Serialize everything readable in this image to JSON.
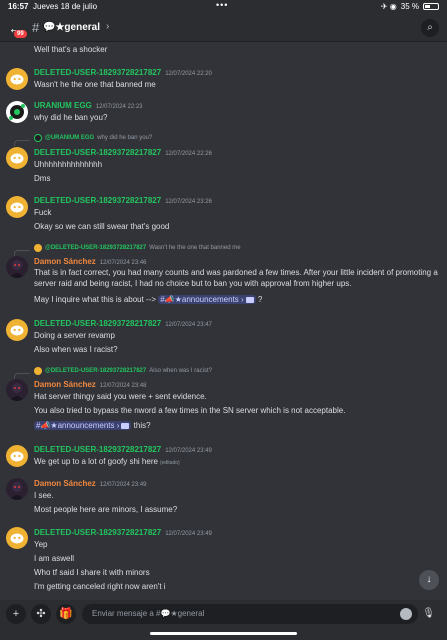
{
  "status": {
    "time": "16:57",
    "date": "Jueves 18 de julio",
    "dots": "•••",
    "icons": "✈ ◉",
    "battery": "35 %",
    "battery_level": 0.35
  },
  "header": {
    "back": "←",
    "unread_badge": "99",
    "hash": "#",
    "title": "💬★general",
    "chevron": "›",
    "search_icon": "⌕"
  },
  "messages": {
    "m0": {
      "text": "Well that's a shocker"
    },
    "m1": {
      "author": "DELETED-USER-18293728217827",
      "time": "12/07/2024 22:20",
      "text": "Wasn't he the one that banned me"
    },
    "m2": {
      "author": "URANIUM EGG",
      "time": "12/07/2024 22:23",
      "text": "why did he ban you?"
    },
    "m3": {
      "reply_name": "@URANIUM EGG",
      "reply_text": "why did he ban you?",
      "author": "DELETED-USER-18293728217827",
      "time": "12/07/2024 22:26",
      "text1": "Uhhhhhhhhhhhhhh",
      "text2": "Dms"
    },
    "m4": {
      "author": "DELETED-USER-18293728217827",
      "time": "12/07/2024 23:26",
      "text1": "Fuck",
      "text2": "Okay so we can still swear that's good"
    },
    "m5": {
      "reply_name": "@DELETED-USER-18293728217827",
      "reply_text": "Wasn't he the one that banned me",
      "author": "Damon Sánchez",
      "time": "12/07/2024 23:46",
      "text1": "That is in fact correct, you had many counts and was pardoned a few times. After your little incident of promoting a server raid and being racist, I had no choice but to ban you with approval from higher ups.",
      "text2_pre": "May I inquire what this is about --> ",
      "mention": "#📣★announcements",
      "mention_chev": "›",
      "text2_post": " ?"
    },
    "m6": {
      "author": "DELETED-USER-18293728217827",
      "time": "12/07/2024 23:47",
      "text1": "Doing a server revamp",
      "text2": "Also when was I racist?"
    },
    "m7": {
      "reply_name": "@DELETED-USER-18293728217827",
      "reply_text": "Also when was I racist?",
      "author": "Damon Sánchez",
      "time": "12/07/2024 23:48",
      "text1": "Hat server thingy said you were + sent evidence.",
      "text2": "You also tried to bypass the nword a few times in the SN server which is not acceptable.",
      "mention": "#📣★announcements",
      "mention_chev": "›",
      "text3_post": " this?"
    },
    "m8": {
      "author": "DELETED-USER-18293728217827",
      "time": "12/07/2024 23:49",
      "text": "We get up to a lot of goofy shi here",
      "edited": "(editado)"
    },
    "m9": {
      "author": "Damon Sánchez",
      "time": "12/07/2024 23:49",
      "text1": "I see.",
      "text2": "Most people here are minors, I assume?"
    },
    "m10": {
      "author": "DELETED-USER-18293728217827",
      "time": "12/07/2024 23:49",
      "text1": "Yep",
      "text2": "I am aswell",
      "text3": "Who tf said I share it with minors",
      "text4": "I'm getting canceled right now aren't i"
    }
  },
  "composer": {
    "plus_icon": "+",
    "apps_icon": "✣",
    "gift_icon": "🎁",
    "placeholder": "Enviar mensaje a #💬★general",
    "mic_icon": "🎙"
  },
  "scroll_icon": "↓",
  "colors": {
    "accent_green": "#22c55e",
    "accent_orange": "#f0883e",
    "deleted_avatar": "#f0b232",
    "background": "#323339"
  }
}
